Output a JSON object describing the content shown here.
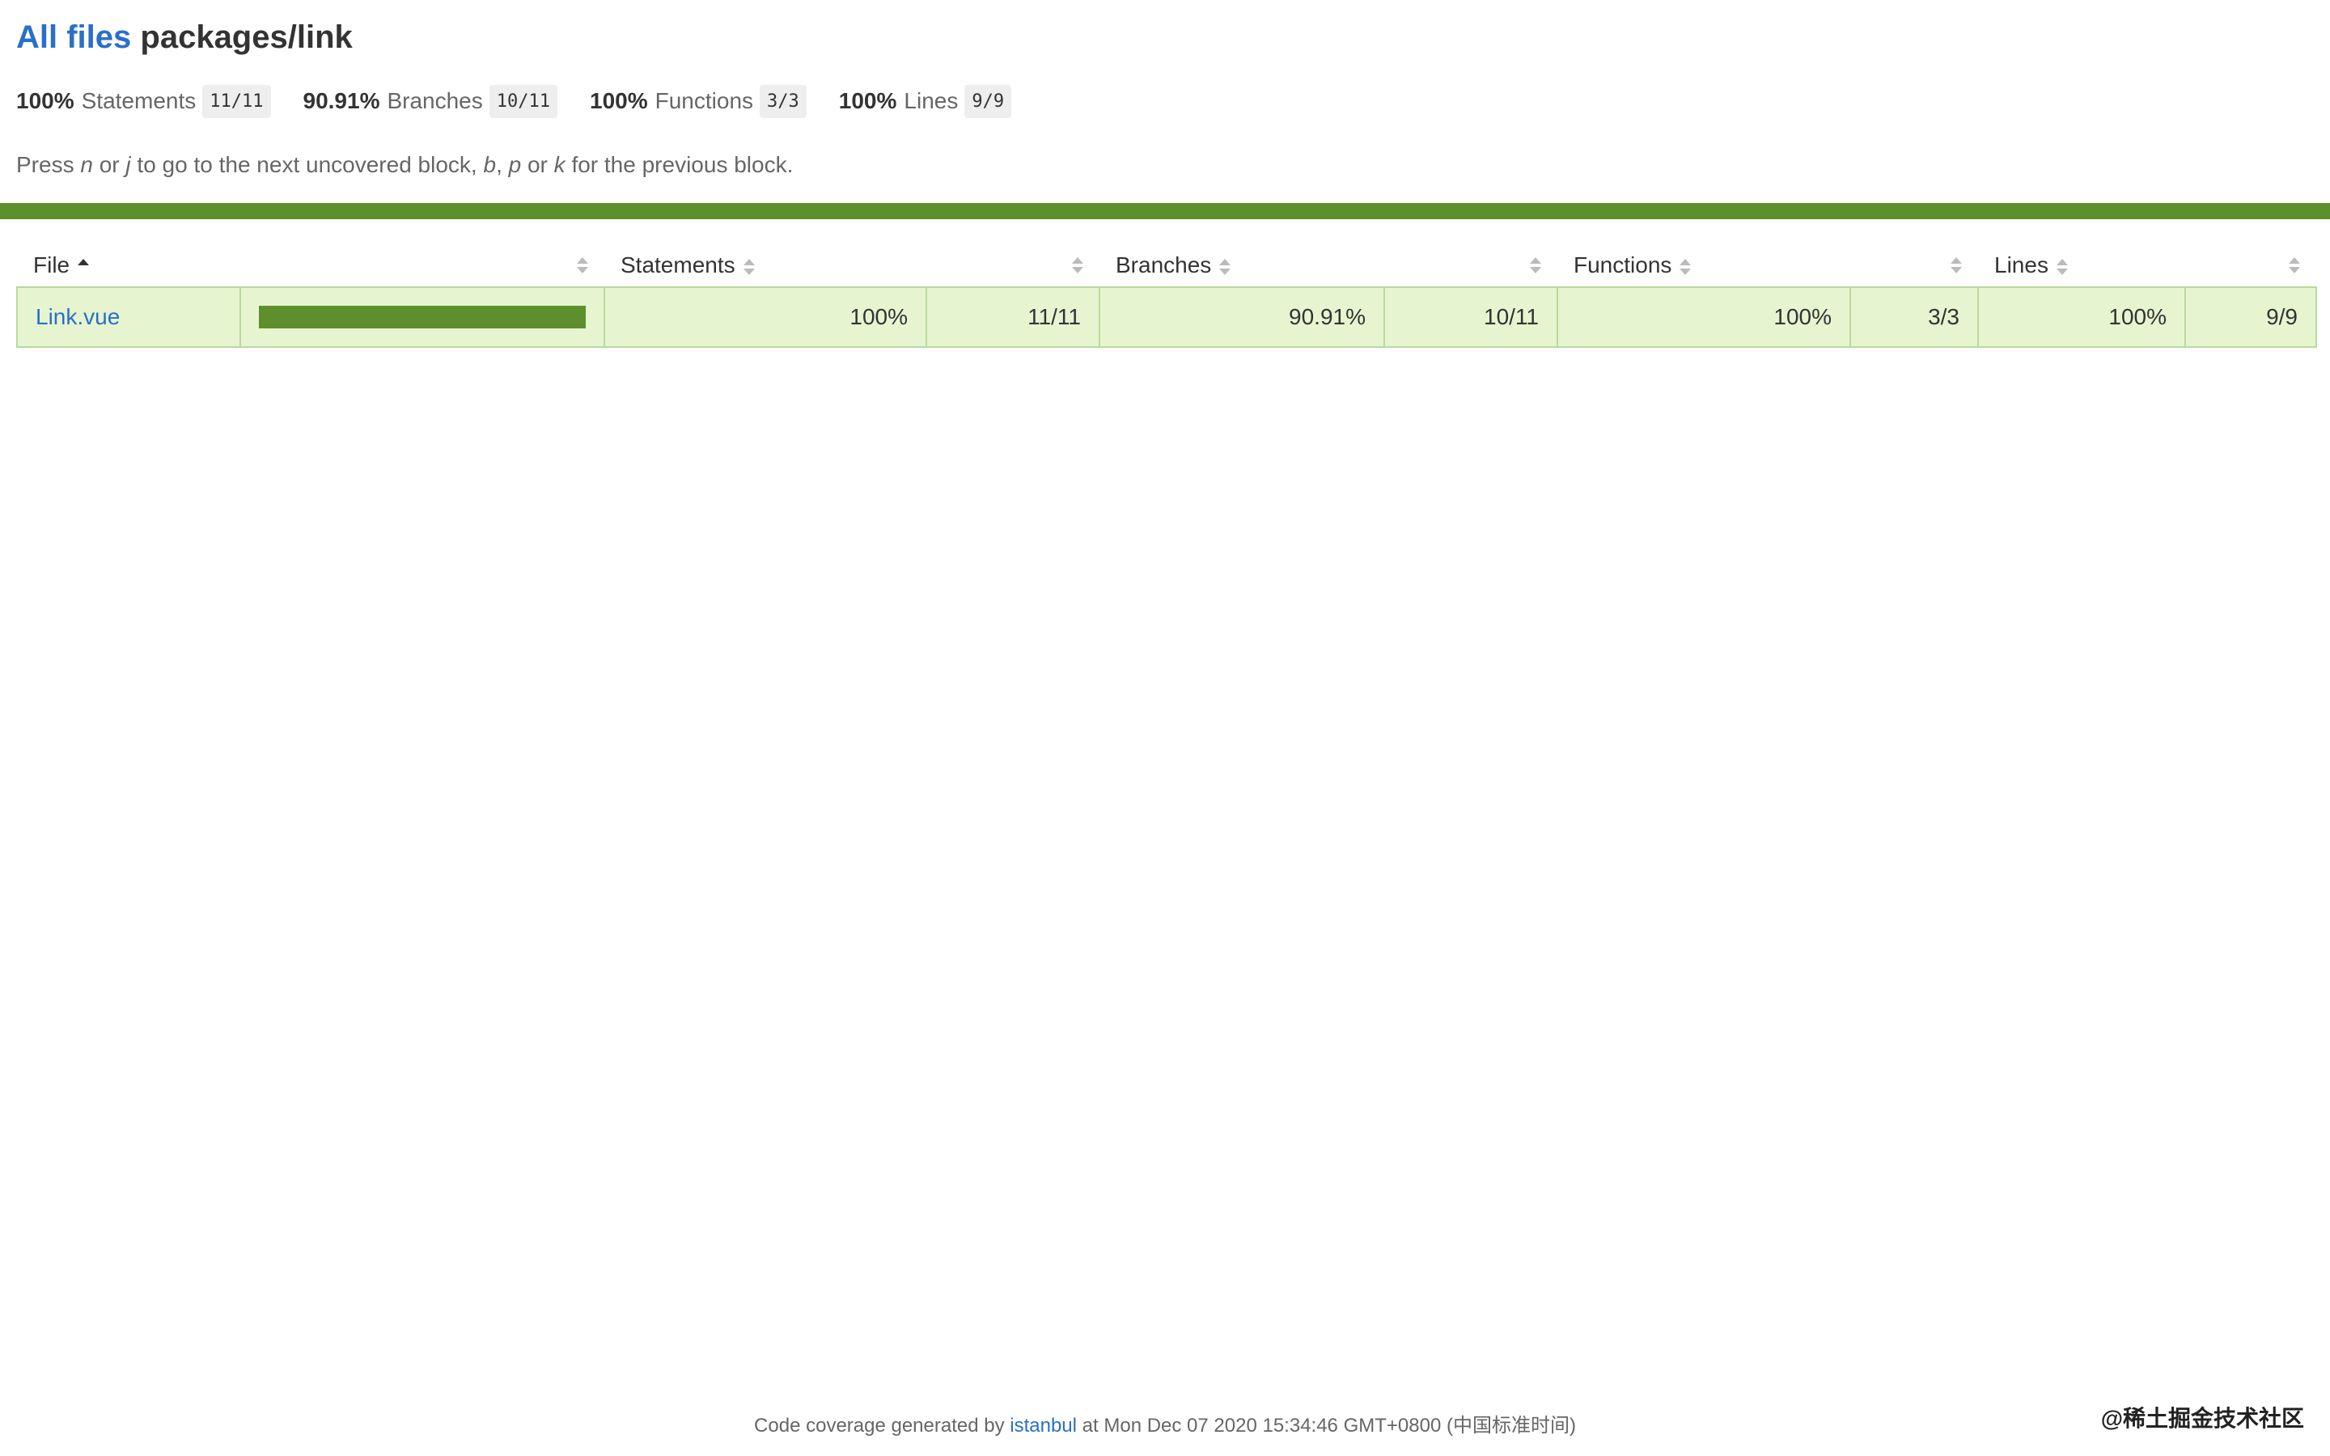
{
  "header": {
    "root_link": "All files",
    "path": "packages/link"
  },
  "summary": [
    {
      "pct": "100%",
      "label": "Statements",
      "fraction": "11/11"
    },
    {
      "pct": "90.91%",
      "label": "Branches",
      "fraction": "10/11"
    },
    {
      "pct": "100%",
      "label": "Functions",
      "fraction": "3/3"
    },
    {
      "pct": "100%",
      "label": "Lines",
      "fraction": "9/9"
    }
  ],
  "hint": {
    "t1": "Press ",
    "k1": "n",
    "t2": " or ",
    "k2": "j",
    "t3": " to go to the next uncovered block, ",
    "k3": "b",
    "t4": ", ",
    "k4": "p",
    "t5": " or ",
    "k5": "k",
    "t6": " for the previous block."
  },
  "colors": {
    "status_high": "#5d8f2d",
    "row_bg": "#e6f5d0",
    "link": "#2a6fc9"
  },
  "table": {
    "headers": {
      "file": "File",
      "statements": "Statements",
      "branches": "Branches",
      "functions": "Functions",
      "lines": "Lines"
    },
    "rows": [
      {
        "file": "Link.vue",
        "coverage_fraction": 1.0,
        "statements_pct": "100%",
        "statements_frac": "11/11",
        "branches_pct": "90.91%",
        "branches_frac": "10/11",
        "functions_pct": "100%",
        "functions_frac": "3/3",
        "lines_pct": "100%",
        "lines_frac": "9/9"
      }
    ]
  },
  "footer": {
    "prefix": "Code coverage generated by ",
    "link": "istanbul",
    "suffix": " at Mon Dec 07 2020 15:34:46 GMT+0800 (中国标准时间)"
  },
  "watermark": "@稀土掘金技术社区"
}
